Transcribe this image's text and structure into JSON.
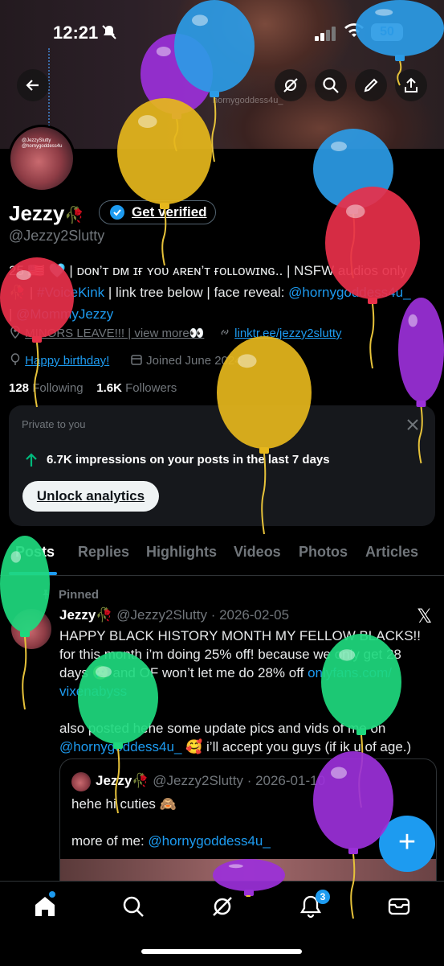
{
  "status_bar": {
    "time": "12:21",
    "battery": "50"
  },
  "banner": {
    "watermark": "hornygoddess4u_"
  },
  "avatar": {
    "caption_line1": "@JezzySlutty",
    "caption_line2": "@hornygoddess4u"
  },
  "profile": {
    "name": "Jezzy",
    "name_emoji": "🥀",
    "verify_label": "Get verified",
    "handle": "@Jezzy2Slutty",
    "bio_line1_prefix": "25 ",
    "bio_line1_flags": "🇺🇸 🩵",
    "bio_line1_text": " | ᴅᴏɴ’ᴛ ᴅᴍ ɪғ ʏᴏᴜ ᴀʀᴇɴ’ᴛ ғᴏʟʟᴏᴡɪɴɢ.. | NSFW audios only",
    "bio_line2_prefix": "🥀 | ",
    "bio_line2_tag": "#VoiceKink",
    "bio_line2_text": " | link tree below | face reveal: ",
    "bio_line2_mention": "@hornygoddess4u_",
    "bio_line3_prefix": "| ",
    "bio_line3_mention": "@MommyJezzy",
    "location": "MINORS LEAVE!!! | view more👀",
    "website": "linktr.ee/jezzy2slutty",
    "birthday": "Happy birthday!",
    "joined": "Joined June 2024",
    "following_count": "128",
    "following_label": "Following",
    "followers_count": "1.6K",
    "followers_label": "Followers"
  },
  "analytics_card": {
    "private_label": "Private to you",
    "impressions_text": "6.7K impressions on your posts in the last 7 days",
    "unlock_label": "Unlock analytics"
  },
  "tabs": [
    {
      "label": "Posts",
      "active": true
    },
    {
      "label": "Replies"
    },
    {
      "label": "Highlights"
    },
    {
      "label": "Videos"
    },
    {
      "label": "Photos"
    },
    {
      "label": "Articles"
    }
  ],
  "post": {
    "pinned_label": "Pinned",
    "author": "Jezzy",
    "author_emoji": "🥀",
    "handle_date": "@Jezzy2Slutty · 2026-02-05",
    "line1": "HAPPY BLACK HISTORY MONTH MY FELLOW BLACKS!!",
    "line2": "for this month i’m doing 25% off! because we only get 28",
    "line3_text": "days 😢 and OF won’t let me do 28% off ",
    "line3_link": "onlyfans.com/",
    "line4_link": "vixenabyss",
    "line5": "also posted hehe some update pics and vids of me on",
    "line6_mention": "@hornygoddess4u_",
    "line6_text": " 🥰 i’ll accept you guys (if ik u of age.)",
    "x_logo": "𝕏",
    "quote": {
      "author": "Jezzy",
      "author_emoji": "🥀",
      "handle_date": "@Jezzy2Slutty · 2026-01-10",
      "line1": "hehe hi cuties 🙈",
      "line2_text": "more of me: ",
      "line2_mention": "@hornygoddess4u_"
    }
  },
  "bottom_nav": {
    "notifications_badge": "3"
  },
  "fab_label": "+",
  "colors": {
    "accent": "#1d9bf0",
    "background": "#000000",
    "muted": "#71767b"
  },
  "balloons": [
    {
      "color": "#9b30d9"
    },
    {
      "color": "#2b9be6"
    },
    {
      "color": "#e6b71c"
    },
    {
      "color": "#2b9be6"
    },
    {
      "color": "#e8304a"
    },
    {
      "color": "#e8304a"
    },
    {
      "color": "#9b30d9"
    },
    {
      "color": "#e6b71c"
    },
    {
      "color": "#1ed97e"
    },
    {
      "color": "#1ed97e"
    },
    {
      "color": "#1ed97e"
    },
    {
      "color": "#9b30d9"
    },
    {
      "color": "#9b30d9"
    },
    {
      "color": "#2b9be6"
    }
  ]
}
